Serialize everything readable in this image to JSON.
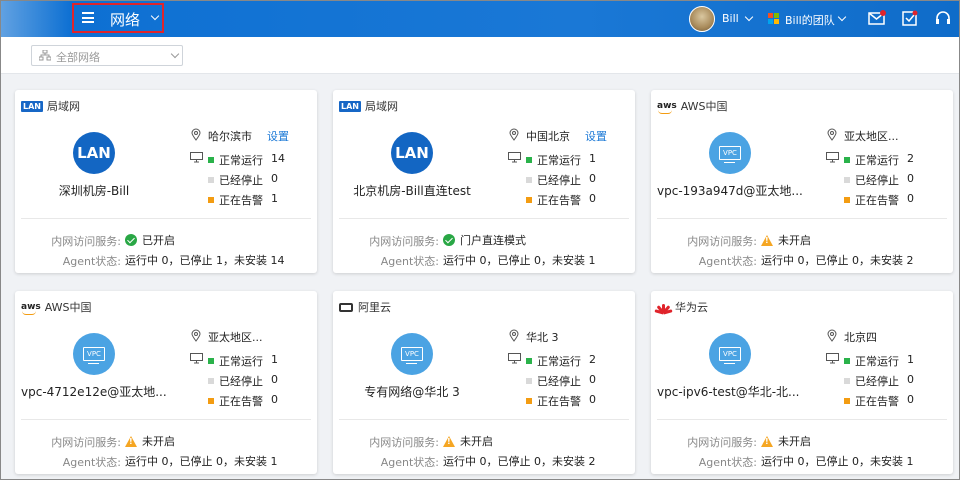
{
  "header": {
    "section_title": "网络",
    "user_name": "Bill",
    "team_name": "Bill的团队"
  },
  "toolbar": {
    "filter_value": "全部网络"
  },
  "colors": {
    "running": "#2ab24a",
    "stopped": "#d9d9d9",
    "alarm": "#f39c12",
    "accent": "#1a78d6"
  },
  "labels": {
    "running": "正常运行",
    "stopped": "已经停止",
    "alarm": "正在告警",
    "service": "内网访问服务:",
    "agent": "Agent状态:",
    "settings": "设置"
  },
  "cards": [
    {
      "provider": "局域网",
      "provider_icon": "lan-badge",
      "icon_text": "LAN",
      "name": "深圳机房-Bill",
      "location": "哈尔滨市",
      "has_settings": true,
      "running": "14",
      "stopped": "0",
      "alarm": "1",
      "service_status": "已开启",
      "service_state": "ok",
      "agent": "运行中 0，已停止 1，未安装 14"
    },
    {
      "provider": "局域网",
      "provider_icon": "lan-badge",
      "icon_text": "LAN",
      "name": "北京机房-Bill直连test",
      "location": "中国北京",
      "has_settings": true,
      "running": "1",
      "stopped": "0",
      "alarm": "0",
      "service_status": "门户直连模式",
      "service_state": "ok",
      "agent": "运行中 0，已停止 0，未安装 1"
    },
    {
      "provider": "AWS中国",
      "provider_icon": "aws-logo",
      "icon_text": "VPC",
      "name": "vpc-193a947d@亚太地...",
      "location": "亚太地区...",
      "has_settings": false,
      "running": "2",
      "stopped": "0",
      "alarm": "0",
      "service_status": "未开启",
      "service_state": "warn",
      "agent": "运行中 0，已停止 0，未安装 2"
    },
    {
      "provider": "AWS中国",
      "provider_icon": "aws-logo",
      "icon_text": "VPC",
      "name": "vpc-4712e12e@亚太地...",
      "location": "亚太地区...",
      "has_settings": false,
      "running": "1",
      "stopped": "0",
      "alarm": "0",
      "service_status": "未开启",
      "service_state": "warn",
      "agent": "运行中 0，已停止 0，未安装 1"
    },
    {
      "provider": "阿里云",
      "provider_icon": "aliyun-logo",
      "icon_text": "VPC",
      "name": "专有网络@华北 3",
      "location": "华北 3",
      "has_settings": false,
      "running": "2",
      "stopped": "0",
      "alarm": "0",
      "service_status": "未开启",
      "service_state": "warn",
      "agent": "运行中 0，已停止 0，未安装 2"
    },
    {
      "provider": "华为云",
      "provider_icon": "huawei-logo",
      "icon_text": "VPC",
      "name": "vpc-ipv6-test@华北-北...",
      "location": "北京四",
      "has_settings": false,
      "running": "1",
      "stopped": "0",
      "alarm": "0",
      "service_status": "未开启",
      "service_state": "warn",
      "agent": "运行中 0，已停止 0，未安装 1"
    }
  ]
}
